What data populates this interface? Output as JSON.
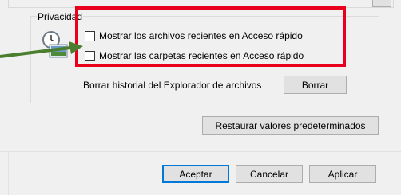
{
  "privacy": {
    "title": "Privacidad",
    "show_recent_files": "Mostrar los archivos recientes en Acceso rápido",
    "show_recent_folders": "Mostrar las carpetas recientes en Acceso rápido",
    "clear_history_label": "Borrar historial del Explorador de archivos",
    "clear_button": "Borrar"
  },
  "restore_button": "Restaurar valores predeterminados",
  "footer": {
    "ok": "Aceptar",
    "cancel": "Cancelar",
    "apply": "Aplicar"
  },
  "annotation": {
    "highlight_color": "#e8001c",
    "arrow_color": "#4a7d2d"
  },
  "checkboxes": {
    "recent_files_checked": false,
    "recent_folders_checked": false
  },
  "icons": {
    "privacy_icon": "clock-document-icon"
  }
}
